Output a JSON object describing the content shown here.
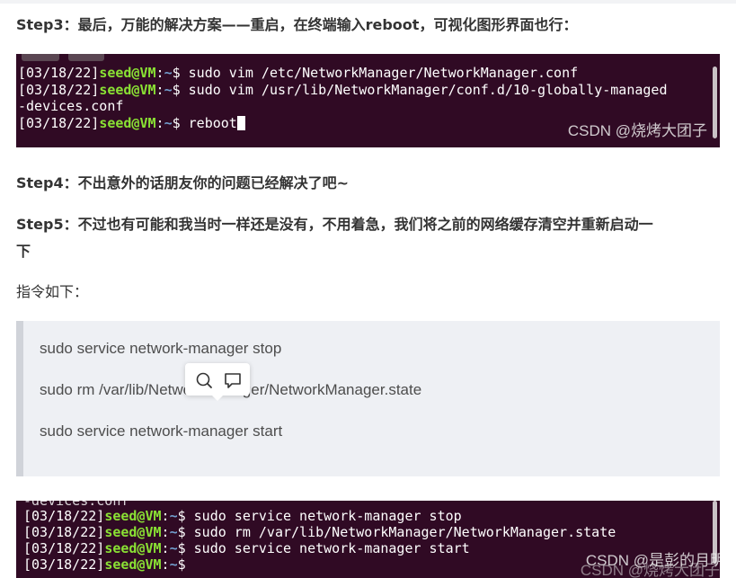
{
  "article": {
    "step3": "Step3：最后，万能的解决方案——重启，在终端输入reboot，可视化图形界面也行：",
    "step4": "Step4：不出意外的话朋友你的问题已经解决了吧~",
    "step5_line1": "Step5：不过也有可能和我当时一样还是没有，不用着急，我们将之前的网络缓存清空并重新启动一",
    "step5_line2": "下",
    "instructions_label": "指令如下："
  },
  "terminal1": {
    "prompt": {
      "date": "[03/18/22]",
      "user": "seed@VM",
      "sep": ":",
      "path": "~",
      "sign": "$"
    },
    "cmd1": " sudo vim /etc/NetworkManager/NetworkManager.conf",
    "cmd2": " sudo vim /usr/lib/NetworkManager/conf.d/10-globally-managed",
    "cmd2_wrap": "-devices.conf",
    "cmd3": " reboot",
    "watermark": "CSDN @烧烤大团子"
  },
  "quote": {
    "lines": [
      "sudo service network-manager stop",
      "sudo rm /var/lib/NetworkManager/NetworkManager.state",
      "sudo service network-manager start"
    ]
  },
  "popup": {
    "icons": [
      "search-icon",
      "comment-icon"
    ]
  },
  "terminal2": {
    "cut_line": "-devices.conf",
    "prompt": {
      "date": "[03/18/22]",
      "user": "seed@VM",
      "sep": ":",
      "path": "~",
      "sign": "$"
    },
    "cmd1": " sudo service network-manager stop",
    "cmd2": " sudo rm /var/lib/NetworkManager/NetworkManager.state",
    "cmd3": " sudo service network-manager start",
    "cmd4": "",
    "watermark": "CSDN @是彭的月明",
    "watermark_under": "CSDN @烧烤大团子"
  },
  "colors": {
    "terminal_bg": "#300a24",
    "prompt_user": "#8ae234",
    "prompt_path": "#729fcf",
    "quote_bg": "#eef0f4",
    "quote_border": "#d0d3d9"
  }
}
